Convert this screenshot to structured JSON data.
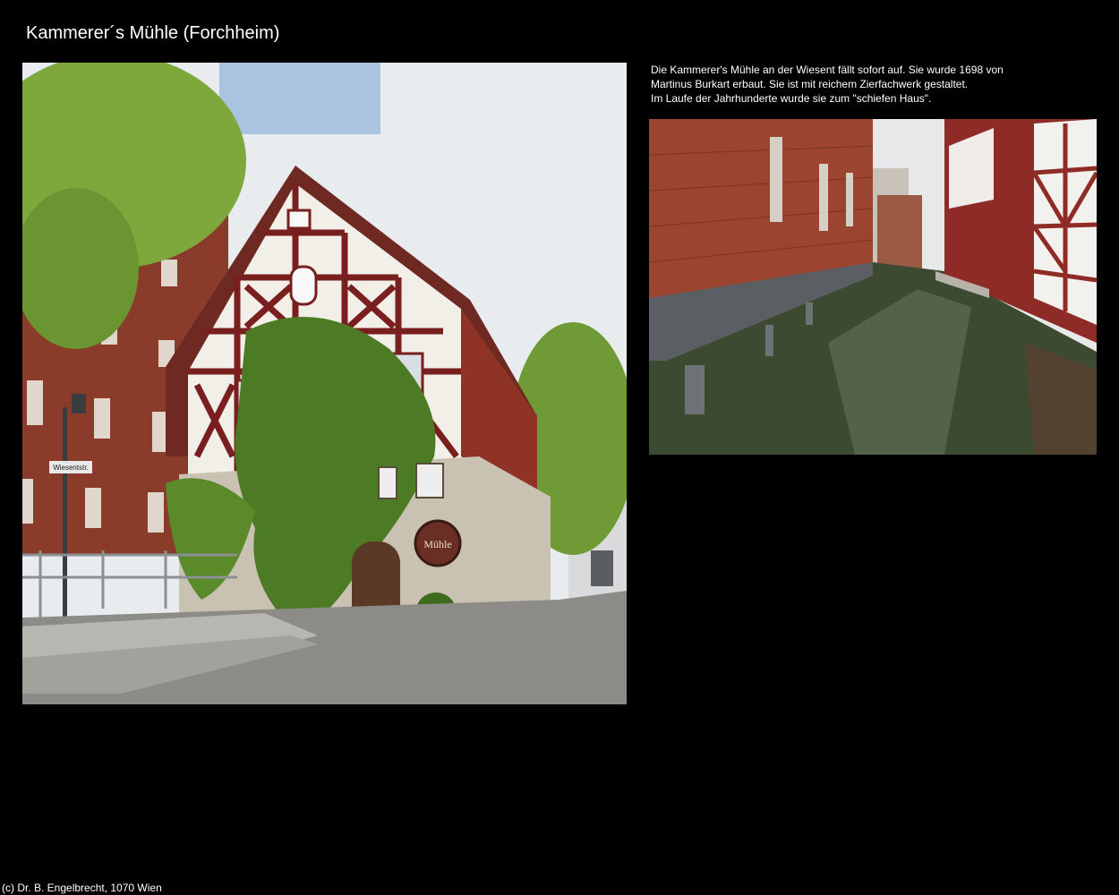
{
  "page": {
    "title": "Kammerer´s Mühle (Forchheim)",
    "copyright": "(c) Dr. B. Engelbrecht, 1070 Wien"
  },
  "description": {
    "lines": [
      "Die Kammerer's Mühle an der Wiesent fällt sofort auf. Sie wurde 1698 von",
      "Martinus Burkart erbaut. Sie ist mit reichem Zierfachwerk gestaltet.",
      "Im Laufe der Jahrhunderte wurde sie zum \"schiefen Haus\"."
    ]
  },
  "photos": {
    "main": {
      "sign_text": "Mühle",
      "street_sign": "Wiesentstr."
    }
  },
  "colors": {
    "background": "#000000",
    "text": "#ffffff",
    "brick": "#8a3b2a",
    "timber": "#7a1f1f",
    "foliage": "#5f8f2c",
    "water": "#3c4a32"
  }
}
